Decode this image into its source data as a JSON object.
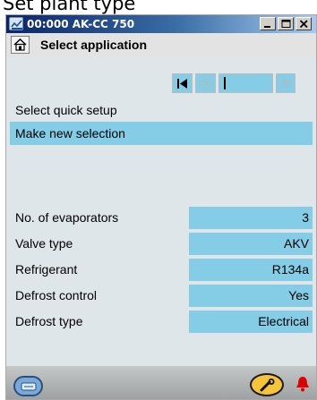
{
  "page_caption": "Set plant type",
  "window": {
    "title": "00:000 AK-CC 750",
    "controls": [
      "minimize-icon",
      "maximize-icon",
      "close-icon"
    ]
  },
  "header": {
    "home_icon": "home-icon",
    "title": "Select application"
  },
  "nav": {
    "first_icon": "first-icon",
    "prev_icon": "prev-icon",
    "field_value": "",
    "next_icon": "next-icon"
  },
  "quick_setup": {
    "label": "Select quick setup",
    "value": "Make new selection"
  },
  "parameters": [
    {
      "label": "No. of evaporators",
      "value": "3"
    },
    {
      "label": "Valve type",
      "value": "AKV"
    },
    {
      "label": "Refrigerant",
      "value": "R134a"
    },
    {
      "label": "Defrost control",
      "value": "Yes"
    },
    {
      "label": "Defrost type",
      "value": "Electrical"
    }
  ],
  "footer": {
    "left_icon": "display-icon",
    "tool_icon": "wrench-icon",
    "alarm_icon": "alarm-bell-icon"
  },
  "colors": {
    "field_bg": "#85cde6",
    "panel_bg": "#dfe6ea",
    "titlebar_start": "#0a246a",
    "alarm": "#e00000"
  }
}
